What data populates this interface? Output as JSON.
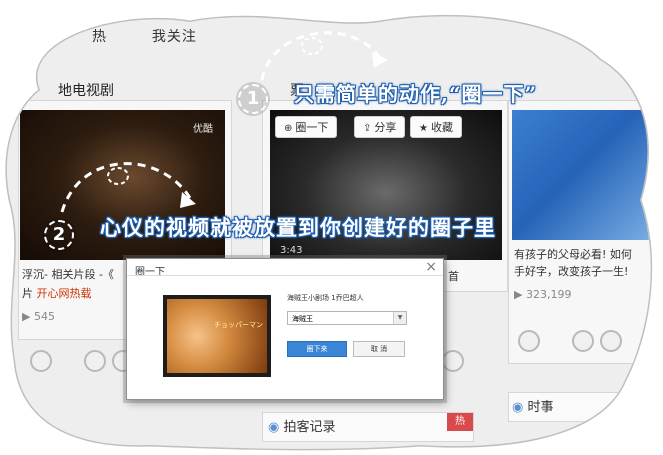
{
  "nav": {
    "partial_left": "热",
    "partial_right": "我关注"
  },
  "columns": [
    {
      "header": "地电视剧"
    },
    {
      "header": "票"
    },
    {
      "header": ""
    }
  ],
  "videos": [
    {
      "brand": "优酷",
      "caption_line1": "浮沉- 相关片段 -《",
      "caption_line2_prefix": "片",
      "caption_line2_link": "开心网热载",
      "views": "545"
    },
    {
      "duration": "3:43",
      "caption_suffix": "首"
    },
    {
      "caption_line1": "有孩子的父母必看! 如何",
      "caption_line2": "手好字，改变孩子一生!",
      "views": "323,199"
    }
  ],
  "overlay_buttons": {
    "circle": "圈一下",
    "share": "分享",
    "favorite": "收藏"
  },
  "dialog": {
    "title": "圈一下",
    "thumb_caption": "チョッパーマン",
    "prompt": "海贼王小剧场 1乔巴超人",
    "select_value": "海贼王",
    "submit": "圈下来",
    "cancel": "取 消"
  },
  "lower_sections": [
    {
      "title": "拍客记录",
      "badge": "热"
    },
    {
      "title": "时事"
    }
  ],
  "annotations": {
    "step1_number": "1",
    "step1_text": "只需简单的动作,“圈一下”",
    "step2_number": "2",
    "step2_text": "心仪的视频就被放置到你创建好的圈子里"
  },
  "colors": {
    "annotation_outline": "#1f5fae",
    "hot_badge": "#d94a4a",
    "primary_button": "#3b85d6",
    "link_red": "#cc3300"
  }
}
